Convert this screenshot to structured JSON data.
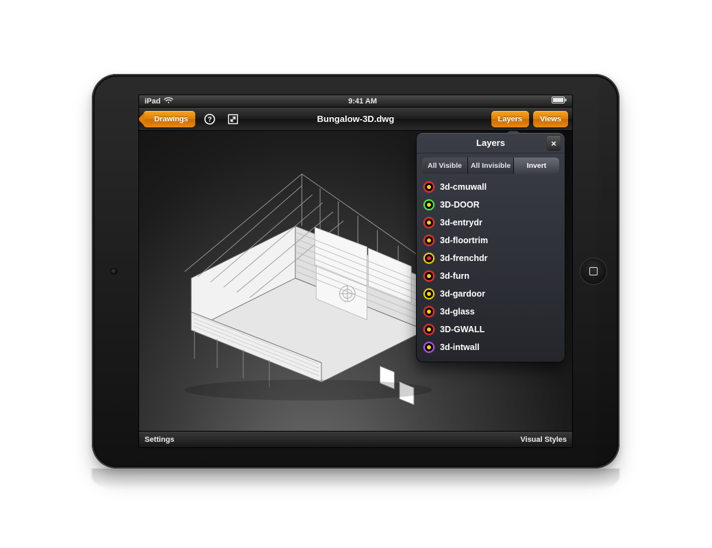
{
  "statusbar": {
    "device": "iPad",
    "time": "9:41 AM"
  },
  "toolbar": {
    "back_label": "Drawings",
    "title": "Bungalow-3D.dwg",
    "layers_label": "Layers",
    "views_label": "Views"
  },
  "popover": {
    "title": "Layers",
    "segments": {
      "all_visible": "All Visible",
      "all_invisible": "All Invisible",
      "invert": "Invert"
    },
    "layers": [
      {
        "name": "3d-cmuwall",
        "ring": "#ff2a2a",
        "dot": "#ffd400"
      },
      {
        "name": "3D-DOOR",
        "ring": "#36ff36",
        "dot": "#ffd400"
      },
      {
        "name": "3d-entrydr",
        "ring": "#ff2a2a",
        "dot": "#ffd400"
      },
      {
        "name": "3d-floortrim",
        "ring": "#ff2a2a",
        "dot": "#ffd400"
      },
      {
        "name": "3d-frenchdr",
        "ring": "#ffd400",
        "dot": "#ff2a2a"
      },
      {
        "name": "3d-furn",
        "ring": "#ff2a2a",
        "dot": "#ffd400"
      },
      {
        "name": "3d-gardoor",
        "ring": "#ffd400",
        "dot": "#ffd400"
      },
      {
        "name": "3d-glass",
        "ring": "#ff2a2a",
        "dot": "#ffd400"
      },
      {
        "name": "3D-GWALL",
        "ring": "#ff2a2a",
        "dot": "#ffd400"
      },
      {
        "name": "3d-intwall",
        "ring": "#b84dff",
        "dot": "#ffd400"
      }
    ]
  },
  "bottombar": {
    "settings": "Settings",
    "visual_styles": "Visual Styles"
  }
}
